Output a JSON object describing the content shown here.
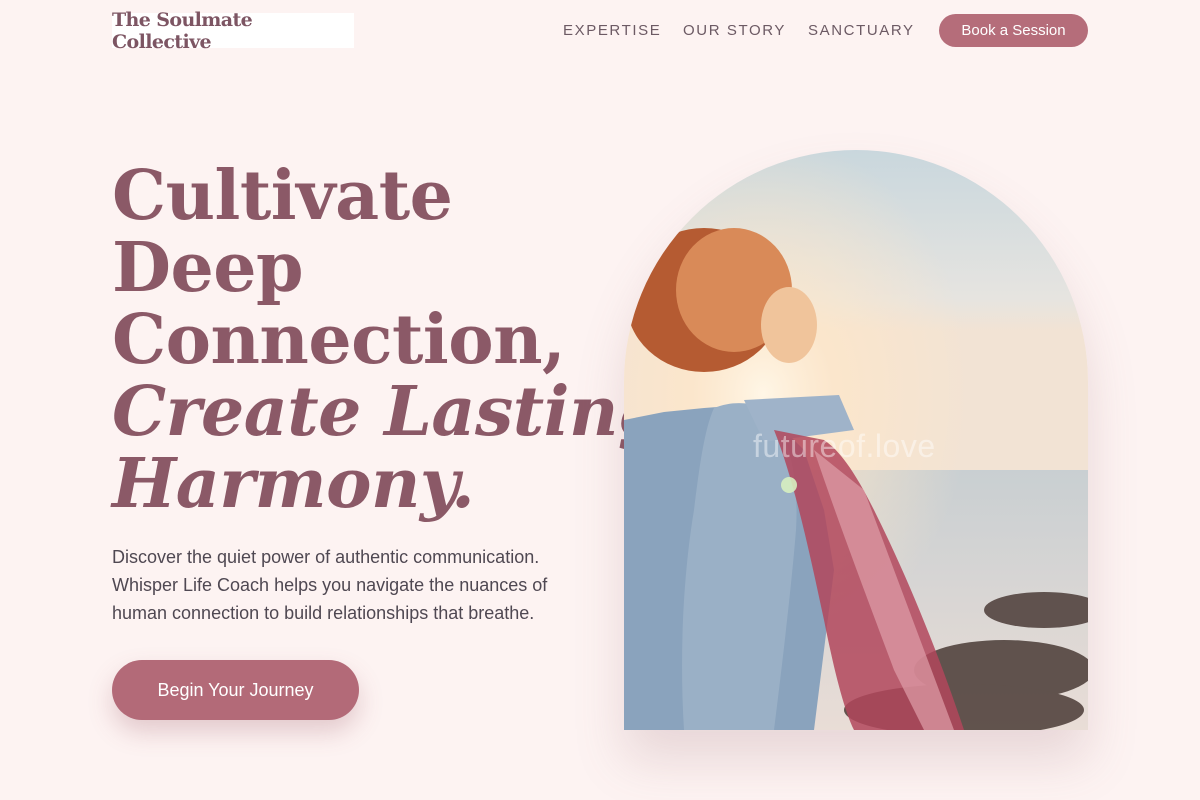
{
  "brand": {
    "name": "The Soulmate Collective"
  },
  "nav": {
    "items": [
      {
        "label": "EXPERTISE"
      },
      {
        "label": "OUR STORY"
      },
      {
        "label": "SANCTUARY"
      }
    ],
    "cta_label": "Book a Session"
  },
  "hero": {
    "headline_lines": [
      "Cultivate",
      "Deep",
      "Connection,"
    ],
    "headline_italic_lines": [
      "Create Lasting",
      "Harmony."
    ],
    "description": "Discover the quiet power of authentic communication. Whisper Life Coach helps you navigate the nuances of human connection to build relationships that breathe.",
    "cta_label": "Begin Your Journey",
    "image": {
      "subject": "woman-arms-outstretched-at-sunset-beach",
      "watermark": "futureof.love"
    }
  },
  "colors": {
    "background": "#fdf3f2",
    "accent": "#b56d7a",
    "headline": "#8b5967"
  }
}
